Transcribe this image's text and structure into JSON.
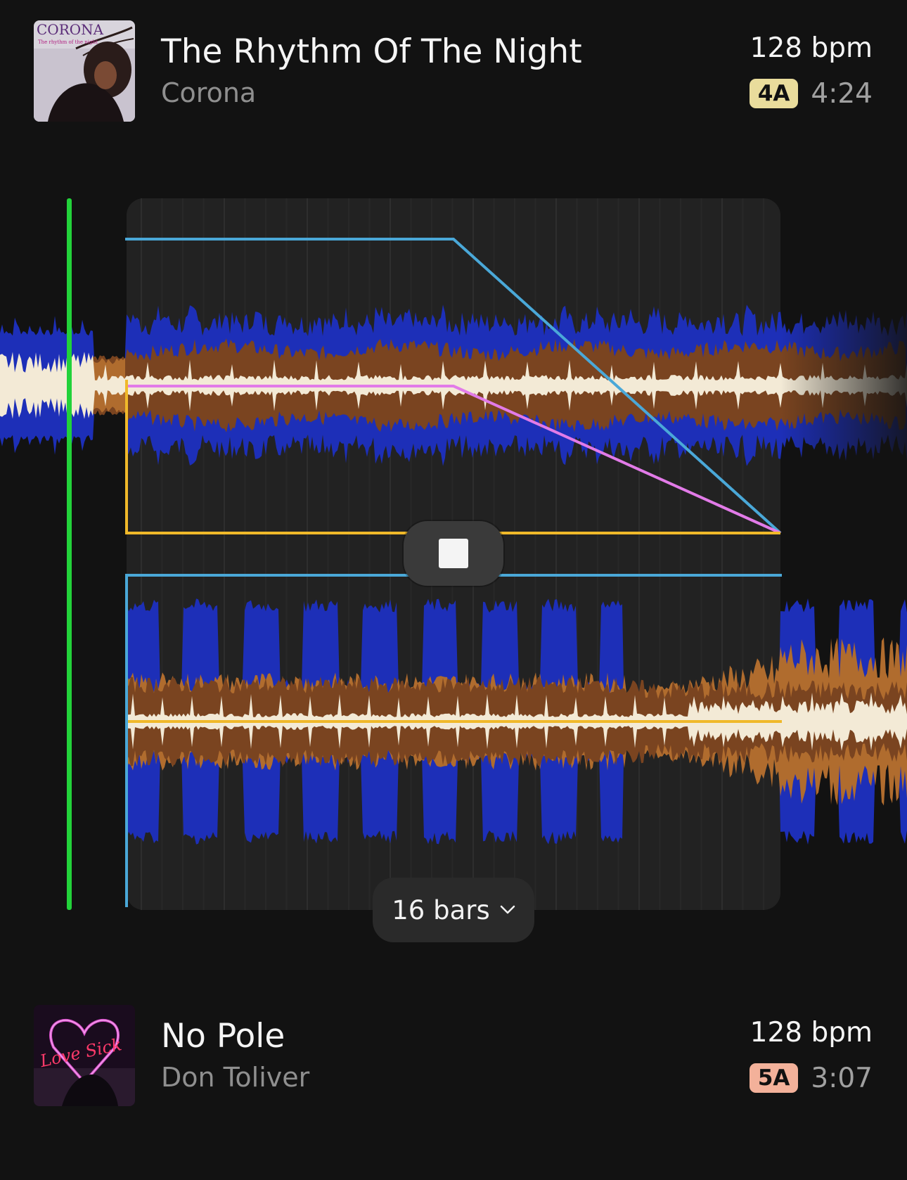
{
  "tracks": [
    {
      "title": "The Rhythm Of The Night",
      "artist": "Corona",
      "bpm": "128 bpm",
      "key": "4A",
      "key_color": "#e9dc9c",
      "duration": "4:24",
      "art_text": "CORONA",
      "art_subtext": "The rhythm of the night"
    },
    {
      "title": "No Pole",
      "artist": "Don Toliver",
      "bpm": "128 bpm",
      "key": "5A",
      "key_color": "#f3b19a",
      "duration": "3:07",
      "art_text": "Love Sick"
    }
  ],
  "transition": {
    "length_label": "16 bars",
    "stop_label": "stop"
  },
  "colors": {
    "playhead": "#22d23a",
    "volume_curve": "#4aa8d8",
    "mid_curve": "#e27be8",
    "bass_curve": "#f0b92a",
    "wave_low": "#1d2fb8",
    "wave_mid": "#7a4420",
    "wave_mid_light": "#b06c2e",
    "wave_high": "#f3ead6"
  }
}
